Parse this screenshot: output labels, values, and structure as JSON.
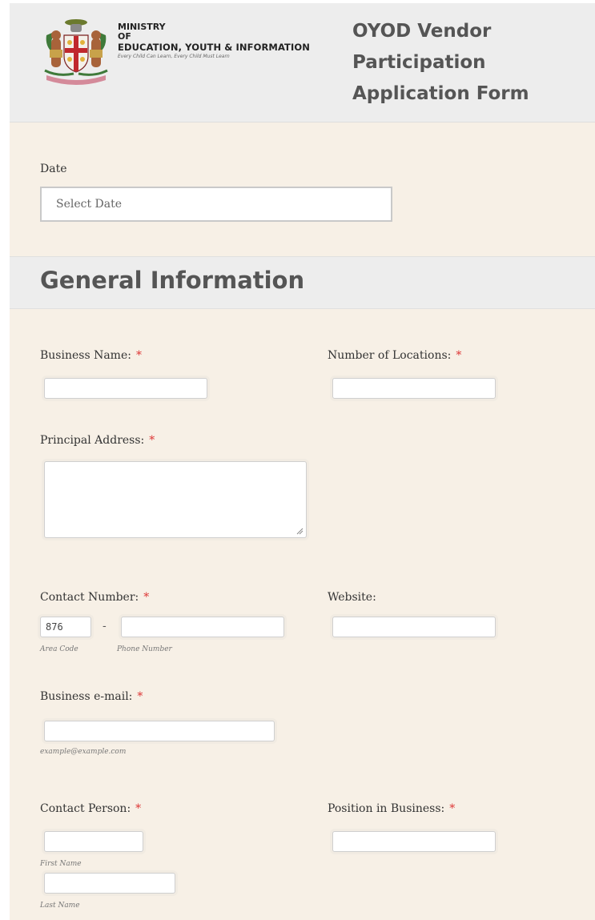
{
  "header": {
    "ministry_line1": "MINISTRY",
    "ministry_line2": "OF",
    "ministry_line3": "EDUCATION, YOUTH & INFORMATION",
    "motto": "Every Child Can Learn, Every Child Must Learn",
    "title_line1": "OYOD Vendor",
    "title_line2": "Participation",
    "title_line3": "Application Form",
    "logo_icon": "jamaica-coat-of-arms-icon"
  },
  "date_section": {
    "label": "Date",
    "placeholder": "Select Date"
  },
  "general_info": {
    "title": "General Information",
    "required_mark": "*",
    "business_name": {
      "label": "Business Name:",
      "value": ""
    },
    "num_locations": {
      "label": "Number of Locations:",
      "value": ""
    },
    "principal_address": {
      "label": "Principal Address:",
      "value": ""
    },
    "contact_number": {
      "label": "Contact Number:",
      "area_code_value": "876",
      "separator": "-",
      "area_code_sublabel": "Area Code",
      "phone_sublabel": "Phone Number",
      "phone_value": ""
    },
    "website": {
      "label": "Website:",
      "value": ""
    },
    "business_email": {
      "label": "Business e-mail:",
      "sublabel": "example@example.com",
      "value": ""
    },
    "contact_person": {
      "label": "Contact Person:",
      "first_sublabel": "First Name",
      "last_sublabel": "Last Name",
      "first_value": "",
      "last_value": ""
    },
    "position": {
      "label": "Position in Business:",
      "value": ""
    }
  },
  "colors": {
    "form_background": "#f7f0e6",
    "header_background": "#ededed",
    "required_star": "#dd3333",
    "heading_text": "#555555"
  }
}
